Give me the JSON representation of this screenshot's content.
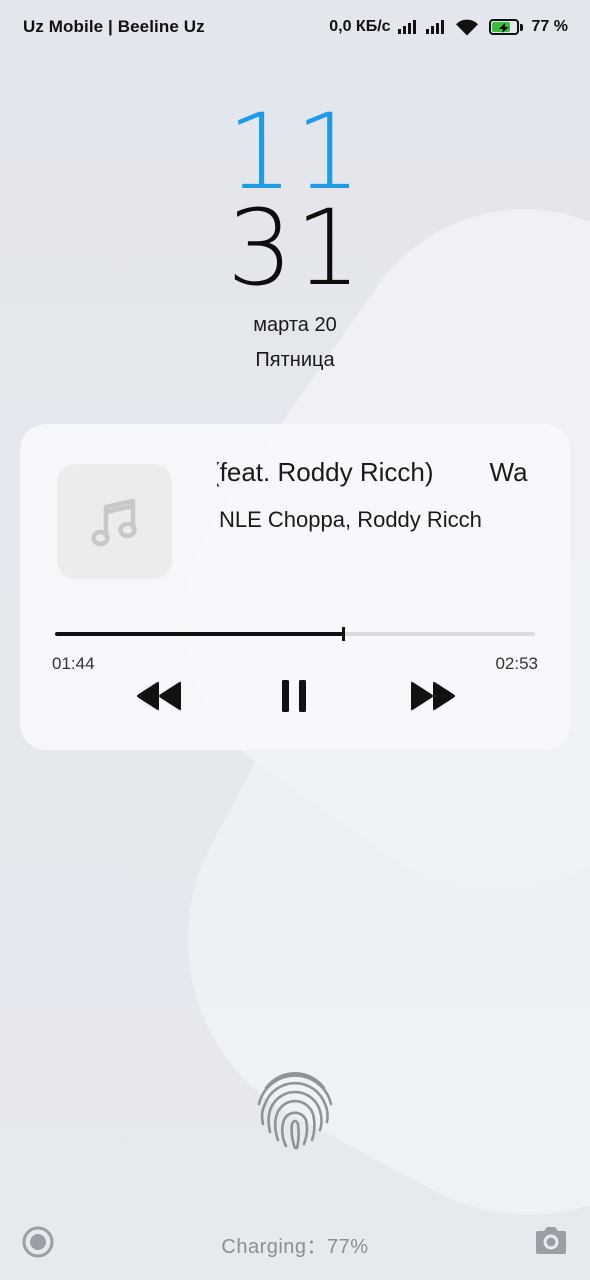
{
  "status_bar": {
    "carrier": "Uz Mobile | Beeline Uz",
    "network_speed": "0,0 КБ/с",
    "battery_percent_label": "77 %",
    "battery_level": 0.77,
    "icons": [
      "signal-1-icon",
      "signal-2-icon",
      "wifi-icon",
      "battery-charging-icon"
    ]
  },
  "clock": {
    "hour": "11",
    "minute": "31",
    "date": "марта 20",
    "weekday": "Пятница",
    "hour_color": "#1e9be6"
  },
  "player": {
    "title_visible": "(feat. Roddy Ricch)",
    "title_next_fragment": "Wa",
    "artist": "NLE Choppa, Roddy Ricch",
    "album_art_icon": "music-note-icon",
    "elapsed": "01:44",
    "total": "02:53",
    "progress_fraction": 0.6,
    "controls": [
      "previous-icon",
      "pause-icon",
      "next-icon"
    ]
  },
  "bottom": {
    "left_icon": "record-icon",
    "unlock_icon": "fingerprint-icon",
    "charging": "Charging：77%",
    "right_icon": "camera-icon"
  }
}
